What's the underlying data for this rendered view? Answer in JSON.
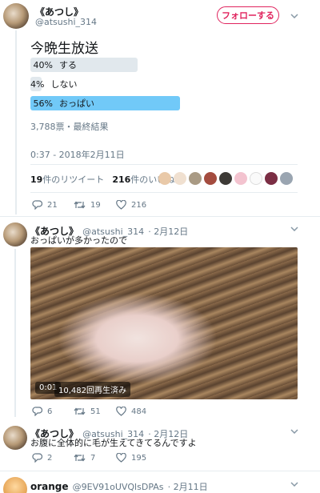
{
  "main_tweet": {
    "display_name": "《あつし》",
    "handle": "@atsushi_314",
    "follow_label": "フォローする",
    "text": "今晩生放送",
    "poll": {
      "options": [
        {
          "pct": "40%",
          "label": "する",
          "value": 40,
          "winner": false
        },
        {
          "pct": "4%",
          "label": "しない",
          "value": 4,
          "winner": false
        },
        {
          "pct": "56%",
          "label": "おっぱい",
          "value": 56,
          "winner": true
        }
      ],
      "summary": "3,788票・最終結果"
    },
    "timestamp": "0:37 - 2018年2月11日",
    "retweets_count": "19",
    "retweets_label": "件のリツイート",
    "likes_count": "216",
    "likes_label": "件のいいね",
    "actions": {
      "reply": "21",
      "retweet": "19",
      "like": "216"
    }
  },
  "reply1": {
    "display_name": "《あつし》",
    "handle": "@atsushi_314",
    "date": "· 2月12日",
    "text": "おっぱいが多かったので",
    "video": {
      "time": "0:01",
      "views": "10,482回再生済み"
    },
    "actions": {
      "reply": "6",
      "retweet": "51",
      "like": "484"
    }
  },
  "reply2": {
    "display_name": "《あつし》",
    "handle": "@atsushi_314",
    "date": "· 2月12日",
    "text": "お腹に全体的に毛が生えてきてるんですよ",
    "actions": {
      "reply": "2",
      "retweet": "7",
      "like": "195"
    }
  },
  "reply3": {
    "display_name": "orange",
    "handle": "@9EV91oUVQlsDPAs",
    "date": "· 2月11日"
  },
  "colors": {
    "poll_bar": "#e1e8ed",
    "poll_winner": "#71c9f8",
    "follow": "#e0245e",
    "divider": "#e6ecf0"
  }
}
